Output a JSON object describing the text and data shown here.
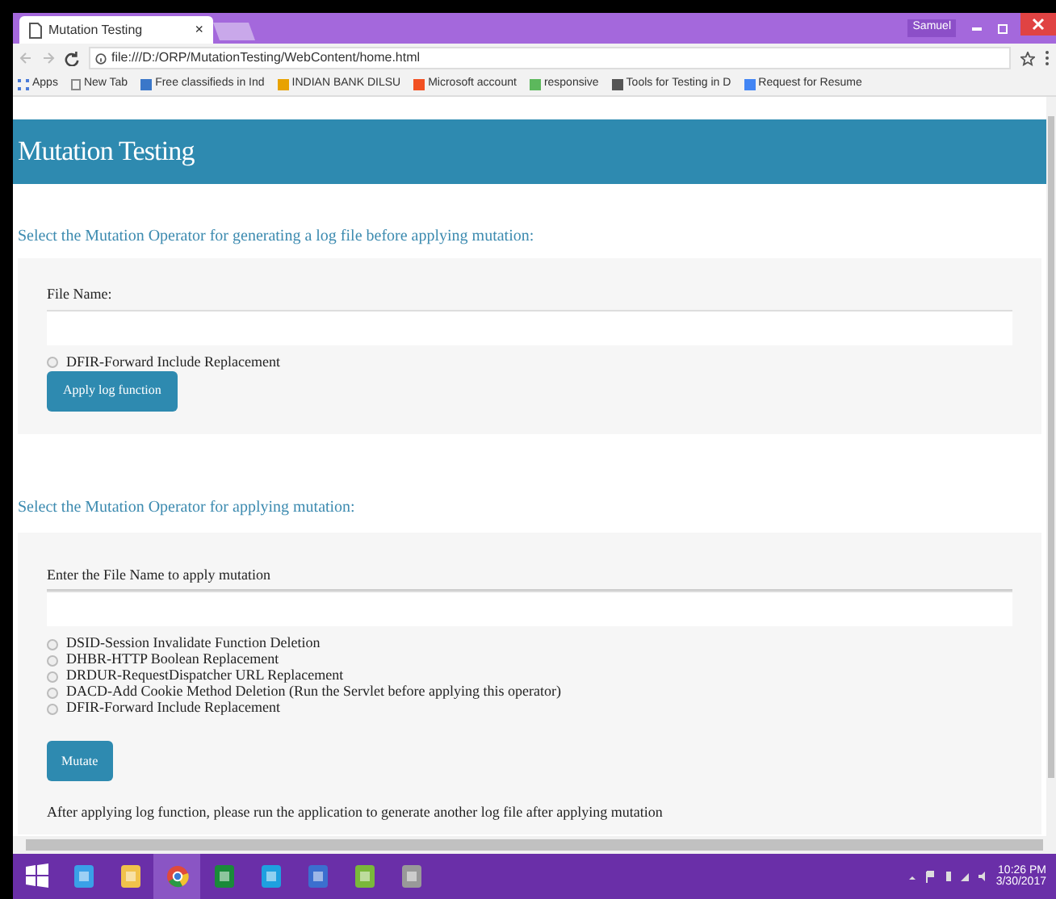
{
  "browser": {
    "tab_title": "Mutation Testing",
    "tab_close": "×",
    "user": "Samuel",
    "url": "file:///D:/ORP/MutationTesting/WebContent/home.html",
    "bookmarks": [
      {
        "label": "Apps",
        "kind": "apps"
      },
      {
        "label": "New Tab",
        "kind": "page"
      },
      {
        "label": "Free classifieds in Ind",
        "kind": "olx"
      },
      {
        "label": "INDIAN BANK DILSU",
        "kind": "bank"
      },
      {
        "label": "Microsoft account",
        "kind": "ms"
      },
      {
        "label": "responsive",
        "kind": "green"
      },
      {
        "label": "Tools for Testing in D",
        "kind": "tool"
      },
      {
        "label": "Request for Resume",
        "kind": "google"
      }
    ]
  },
  "page": {
    "header": "Mutation Testing",
    "sections": [
      {
        "heading": "Select the Mutation Operator for generating a log file before applying mutation:",
        "field_label": "File Name:",
        "label_underlined": false,
        "options": [
          {
            "label": "DFIR-Forward Include Replacement",
            "checked": false
          }
        ],
        "button": "Apply log function"
      },
      {
        "heading": "Select the Mutation Operator for applying mutation:",
        "field_label": "Enter the File Name to apply mutation",
        "label_underlined": true,
        "options": [
          {
            "label": "DSID-Session Invalidate Function Deletion",
            "checked": false
          },
          {
            "label": "DHBR-HTTP Boolean Replacement",
            "checked": false
          },
          {
            "label": "DRDUR-RequestDispatcher URL Replacement",
            "checked": false
          },
          {
            "label": "DACD-Add Cookie Method Deletion (Run the Servlet before applying this operator)",
            "checked": false
          },
          {
            "label": "DFIR-Forward Include Replacement",
            "checked": false
          }
        ],
        "button": "Mutate",
        "note": "After applying log function, please run the application to generate another log file after applying mutation"
      }
    ]
  },
  "taskbar": {
    "time": "10:26 PM",
    "date": "3/30/2017"
  }
}
